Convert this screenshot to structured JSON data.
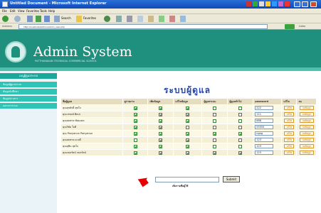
{
  "window": {
    "title": "Untitled Document - Microsoft Internet Explorer"
  },
  "menu": [
    "File",
    "Edit",
    "View",
    "Favorites",
    "Tools",
    "Help"
  ],
  "toolbar": {
    "search_label": "Search",
    "favorites_label": "Favorites"
  },
  "address": {
    "label": "Address",
    "url": "http://localhost/admin/admin_user.php",
    "links_label": "Links"
  },
  "banner": {
    "title": "Admin System",
    "subtitle": "PATTHANAKAN TECHNICAL COMMERCIAL SCHOOL"
  },
  "sidebar": {
    "heading": "เมนูผู้ดูแลระบบ",
    "items": [
      "ข้อมูลผู้ดูแลระบบ",
      "ข้อมูลนักศึกษา",
      "ข้อมูลข่าวสาร",
      "ออกจากระบบ"
    ]
  },
  "main": {
    "title": "ระบบผู้ดูแล",
    "columns": [
      "ชื่อผู้ดูแล",
      "ดูรายงาน",
      "เพิ่มข้อมูล",
      "แก้ไขข้อมูล",
      "ผู้ดูแลระบบ",
      "ผู้ดูแลทั่วไป",
      "password",
      "แก้ไข",
      "ลบ"
    ],
    "rows": [
      {
        "name": "คุณสุรศักดิ์ สุขใจ",
        "perms": [
          true,
          true,
          true,
          false,
          false
        ],
        "password": "222"
      },
      {
        "name": "คุณวรพงษ์ ศิลปะ",
        "perms": [
          true,
          true,
          true,
          false,
          false
        ],
        "password": "111"
      },
      {
        "name": "คุณสมชาย ชัยมงคล",
        "perms": [
          true,
          true,
          true,
          false,
          false
        ],
        "password": "888"
      },
      {
        "name": "คุณวิชัย ใจดี",
        "perms": [
          true,
          true,
          false,
          false,
          false
        ],
        "password": "55555"
      },
      {
        "name": "คุณ Panyanun Panyanun",
        "perms": [
          true,
          true,
          true,
          true,
          true
        ],
        "password": "ngng"
      },
      {
        "name": "คุณสมชาย ดวงดี",
        "perms": [
          false,
          true,
          true,
          false,
          false
        ],
        "password": "123"
      },
      {
        "name": "คุณสุชิน สุขใจ",
        "perms": [
          true,
          true,
          true,
          false,
          false
        ],
        "password": "123"
      },
      {
        "name": "คุณกมลรัตน์ กมลรัตน์",
        "perms": [
          true,
          true,
          true,
          true,
          true
        ],
        "password": "123"
      }
    ],
    "edit_label": "แก้ไข",
    "delete_label": "ลบข้อมูล"
  },
  "add": {
    "label": "เพิ่มรายชื่อผู้ใช้",
    "submit_label": "Submit"
  }
}
